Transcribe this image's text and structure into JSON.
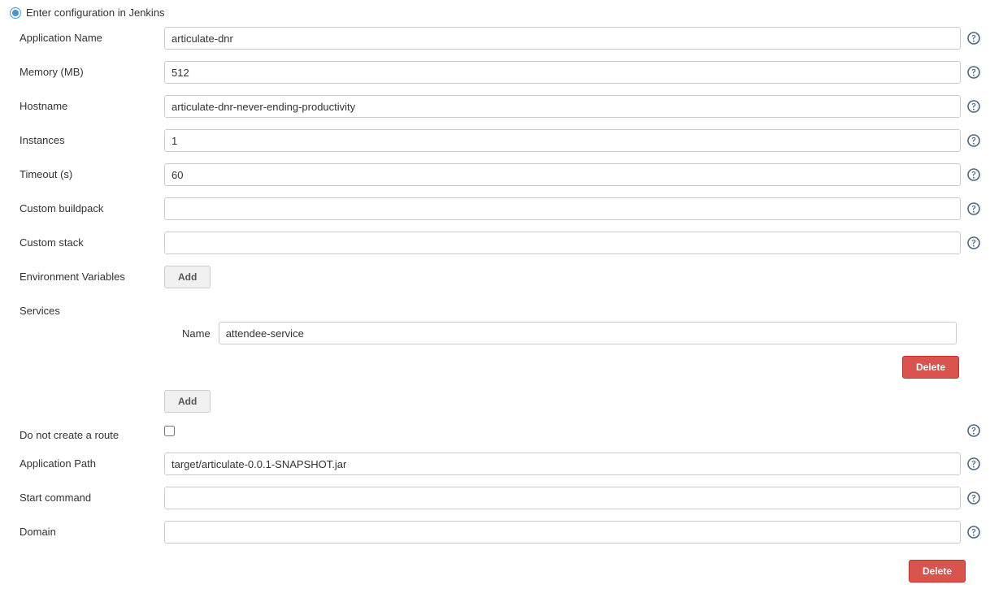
{
  "section": {
    "title": "Enter configuration in Jenkins"
  },
  "labels": {
    "application_name": "Application Name",
    "memory_mb": "Memory (MB)",
    "hostname": "Hostname",
    "instances": "Instances",
    "timeout_s": "Timeout (s)",
    "custom_buildpack": "Custom buildpack",
    "custom_stack": "Custom stack",
    "env_vars": "Environment Variables",
    "services": "Services",
    "service_name": "Name",
    "do_not_create_route": "Do not create a route",
    "application_path": "Application Path",
    "start_command": "Start command",
    "domain": "Domain"
  },
  "values": {
    "application_name": "articulate-dnr",
    "memory_mb": "512",
    "hostname": "articulate-dnr-never-ending-productivity",
    "instances": "1",
    "timeout_s": "60",
    "custom_buildpack": "",
    "custom_stack": "",
    "service_name": "attendee-service",
    "application_path": "target/articulate-0.0.1-SNAPSHOT.jar",
    "start_command": "",
    "domain": ""
  },
  "buttons": {
    "add": "Add",
    "delete": "Delete"
  }
}
